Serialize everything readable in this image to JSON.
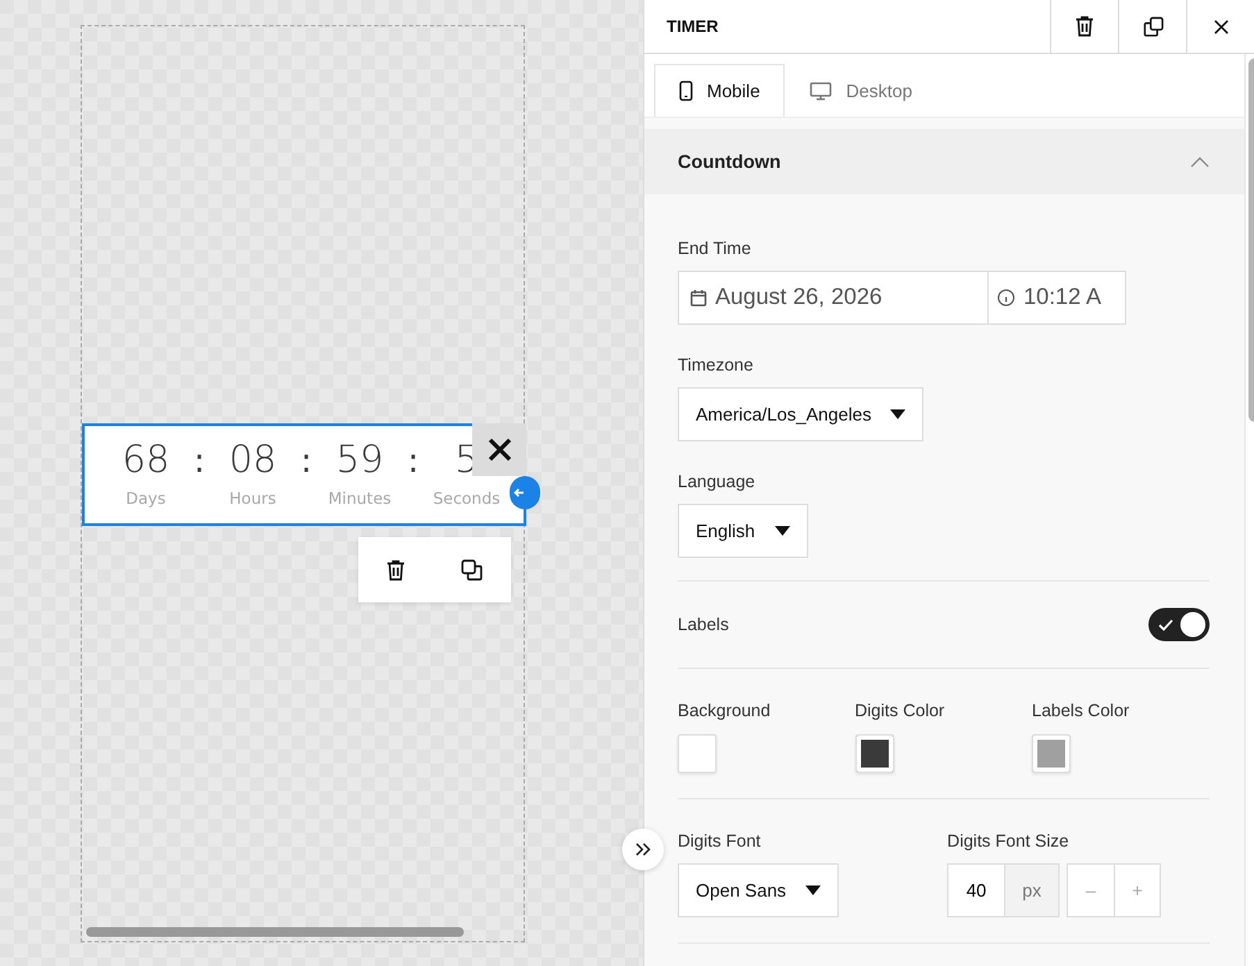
{
  "canvas": {
    "timer": {
      "units": [
        {
          "value": "68",
          "label": "Days",
          "separator": ":"
        },
        {
          "value": "08",
          "label": "Hours",
          "separator": ":"
        },
        {
          "value": "59",
          "label": "Minutes",
          "separator": ":"
        },
        {
          "value": "5",
          "label": "Seconds"
        }
      ]
    }
  },
  "panel": {
    "title": "TIMER",
    "tabs": [
      {
        "label": "Mobile",
        "selected": true,
        "kind": "mobile"
      },
      {
        "label": "Desktop",
        "selected": false,
        "kind": "desktop"
      }
    ],
    "section": {
      "title": "Countdown",
      "expanded": true
    },
    "end_time": {
      "label": "End Time",
      "date": "August 26, 2026",
      "time": "10:12 A"
    },
    "timezone": {
      "label": "Timezone",
      "value": "America/Los_Angeles"
    },
    "language": {
      "label": "Language",
      "value": "English"
    },
    "labels_toggle": {
      "label": "Labels",
      "on": true
    },
    "colors": [
      {
        "label": "Background",
        "color": "#ffffff"
      },
      {
        "label": "Digits Color",
        "color": "#3a3a3a"
      },
      {
        "label": "Labels Color",
        "color": "#a0a0a0"
      }
    ],
    "digits_font": {
      "label": "Digits Font",
      "value": "Open Sans"
    },
    "digits_font_size": {
      "label": "Digits Font Size",
      "value": "40",
      "unit": "px",
      "decrement": "–",
      "increment": "+"
    }
  }
}
